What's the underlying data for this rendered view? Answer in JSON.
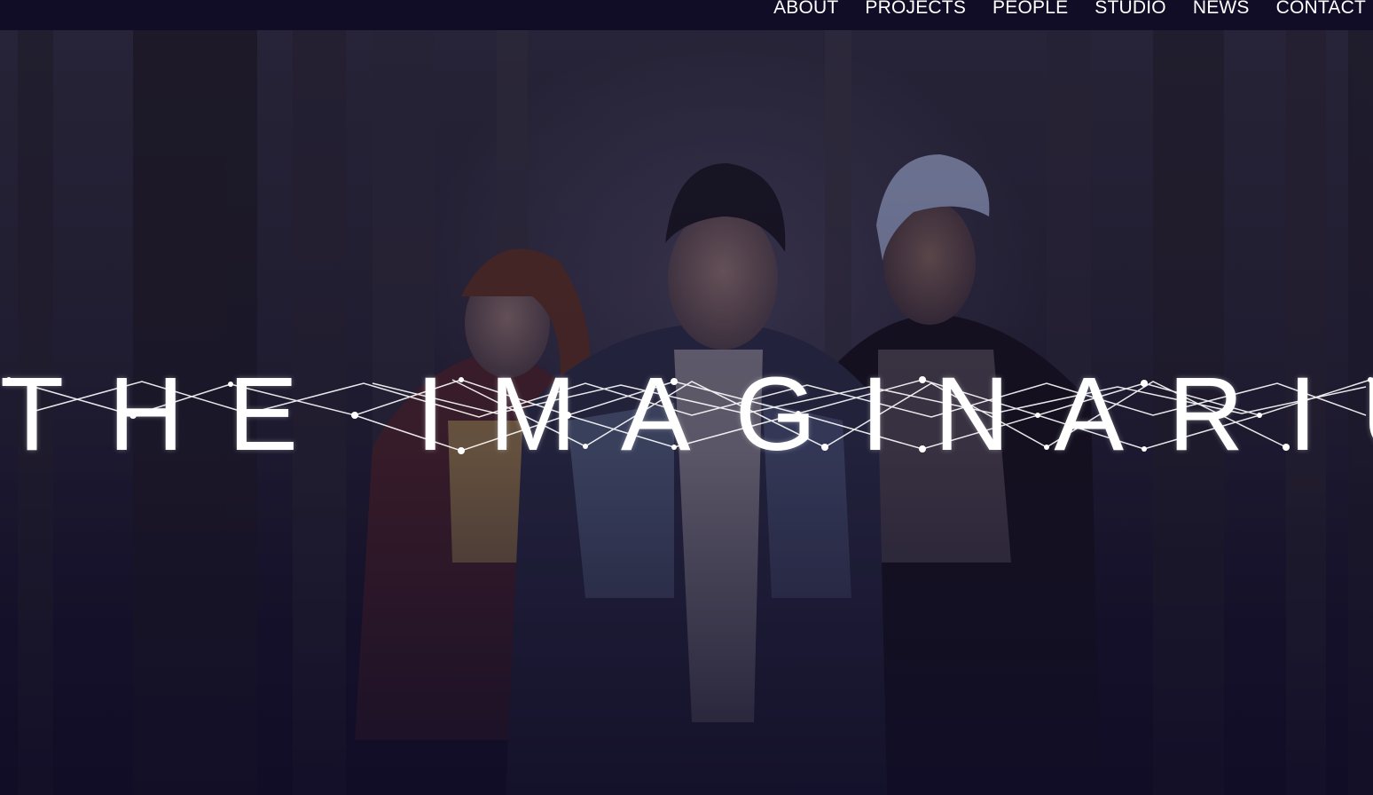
{
  "nav": {
    "items": [
      {
        "label": "ABOUT"
      },
      {
        "label": "PROJECTS"
      },
      {
        "label": "PEOPLE"
      },
      {
        "label": "STUDIO"
      },
      {
        "label": "NEWS"
      },
      {
        "label": "CONTACT"
      }
    ]
  },
  "hero": {
    "title": "THE IMAGINARIUM",
    "background": "dark forest photograph with three young people",
    "overlay_color": "#110d26"
  },
  "colors": {
    "topbar": "#110d26",
    "nav_text": "#ffffff",
    "title": "#ffffff"
  }
}
